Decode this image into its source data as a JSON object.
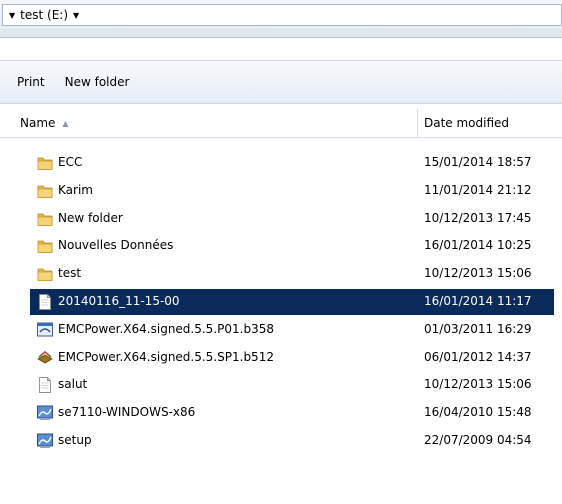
{
  "address": {
    "location": "test (E:)"
  },
  "toolbar": {
    "print_label": "Print",
    "new_folder_label": "New folder"
  },
  "columns": {
    "name": "Name",
    "date_modified": "Date modified"
  },
  "files": [
    {
      "name": "ECC",
      "date": "15/01/2014 18:57",
      "icon": "folder-icon"
    },
    {
      "name": "Karim",
      "date": "11/01/2014 21:12",
      "icon": "folder-icon"
    },
    {
      "name": "New folder",
      "date": "10/12/2013 17:45",
      "icon": "folder-icon"
    },
    {
      "name": "Nouvelles Données",
      "date": "16/01/2014 10:25",
      "icon": "folder-icon"
    },
    {
      "name": "test",
      "date": "10/12/2013 15:06",
      "icon": "folder-icon"
    },
    {
      "name": "20140116_11-15-00",
      "date": "16/01/2014 11:17",
      "icon": "document-icon",
      "selected": true
    },
    {
      "name": "EMCPower.X64.signed.5.5.P01.b358",
      "date": "01/03/2011 16:29",
      "icon": "installer-icon"
    },
    {
      "name": "EMCPower.X64.signed.5.5.SP1.b512",
      "date": "06/01/2012 14:37",
      "icon": "package-icon"
    },
    {
      "name": "salut",
      "date": "10/12/2013 15:06",
      "icon": "document-icon"
    },
    {
      "name": "se7110-WINDOWS-x86",
      "date": "16/04/2010 15:48",
      "icon": "setup-icon"
    },
    {
      "name": "setup",
      "date": "22/07/2009 04:54",
      "icon": "setup-icon"
    }
  ]
}
